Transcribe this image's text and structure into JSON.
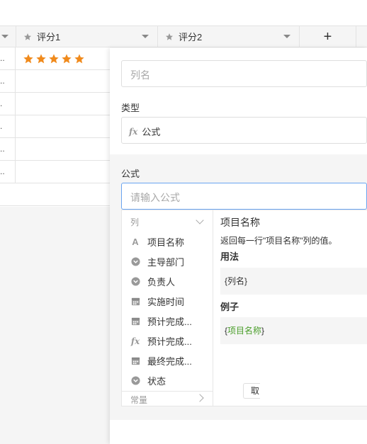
{
  "colors": {
    "accent": "#6aa4f0",
    "star": "#f08a1c",
    "green_text": "#4a9e2a"
  },
  "grid": {
    "columns": [
      {
        "label": "评分1",
        "icon": "star-icon"
      },
      {
        "label": "评分2",
        "icon": "star-icon"
      }
    ],
    "add_column_label": "+",
    "first_column_cells": [
      "..",
      ".",
      ".",
      "..",
      ".."
    ],
    "rating": {
      "value": 5,
      "max": 5
    }
  },
  "panel": {
    "name_placeholder": "列名",
    "type_label": "类型",
    "type_value": "公式",
    "type_icon": "fx-icon",
    "formula_label": "公式",
    "formula_placeholder": "请输入公式",
    "list": {
      "header": "列",
      "items": [
        {
          "label": "项目名称",
          "icon": "text-icon"
        },
        {
          "label": "主导部门",
          "icon": "dropdown-icon"
        },
        {
          "label": "负责人",
          "icon": "dropdown-icon"
        },
        {
          "label": "实施时间",
          "icon": "calendar-icon"
        },
        {
          "label": "预计完成...",
          "icon": "calendar-icon"
        },
        {
          "label": "预计完成...",
          "icon": "fx-icon"
        },
        {
          "label": "最终完成...",
          "icon": "calendar-icon"
        },
        {
          "label": "状态",
          "icon": "dropdown-icon"
        }
      ],
      "constants_label": "常量"
    },
    "detail": {
      "title": "项目名称",
      "description": "返回每一行\"项目名称\"列的值。",
      "usage_heading": "用法",
      "usage_code": "{列名}",
      "example_heading": "例子",
      "example_open": "{",
      "example_name": "项目名称",
      "example_close": "}"
    },
    "footer_button_peek": "取"
  }
}
